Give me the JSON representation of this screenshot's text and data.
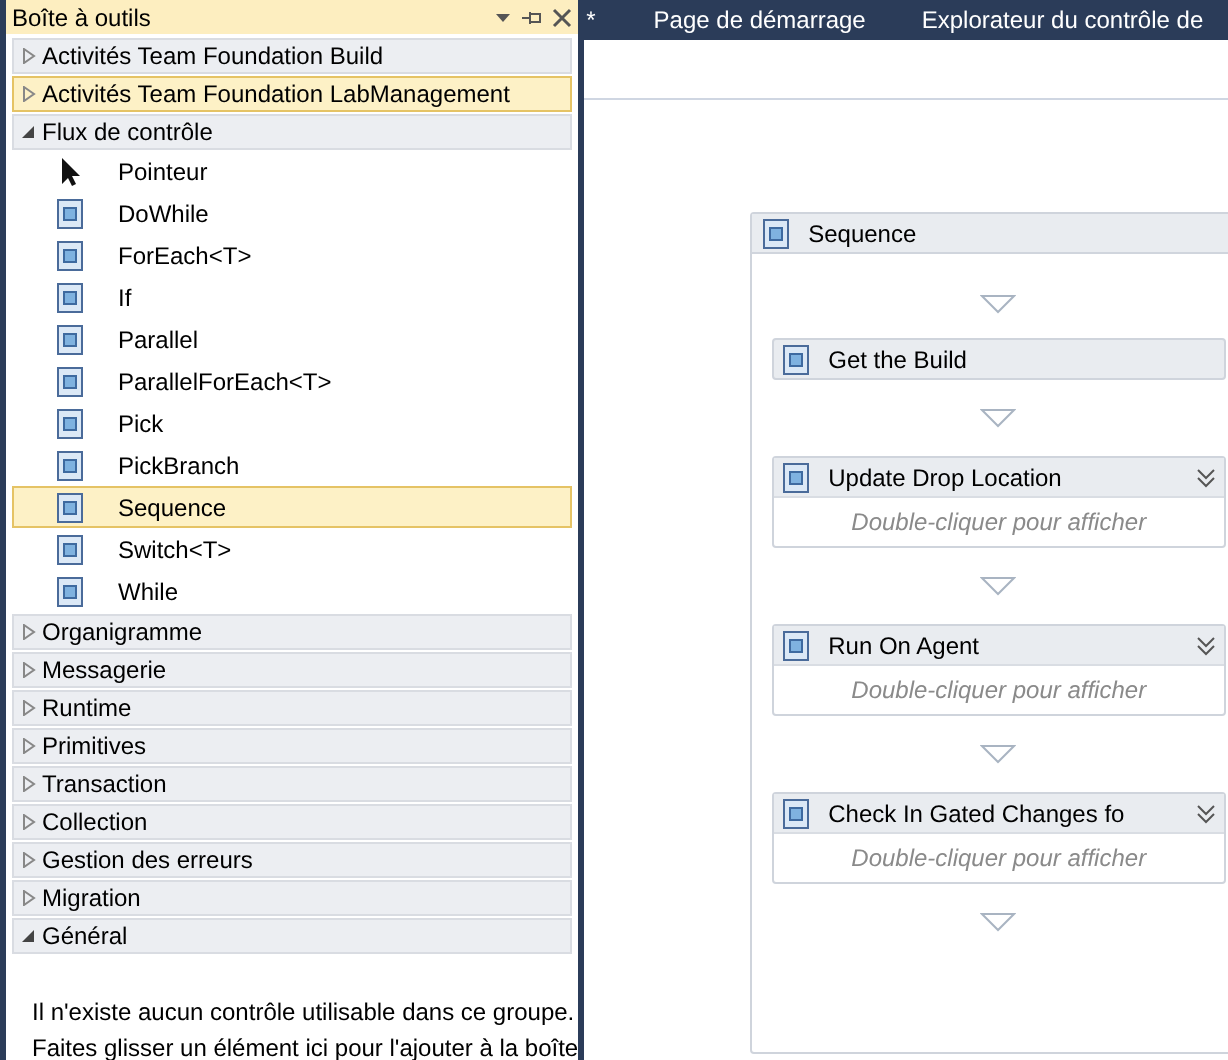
{
  "toolbox": {
    "title": "Boîte à outils",
    "categories": [
      {
        "label": "Activités Team Foundation Build",
        "expanded": false,
        "highlighted": false
      },
      {
        "label": "Activités Team Foundation LabManagement",
        "expanded": false,
        "highlighted": true
      },
      {
        "label": "Flux de contrôle",
        "expanded": true,
        "highlighted": false,
        "items": [
          {
            "label": "Pointeur",
            "kind": "pointer",
            "selected": false
          },
          {
            "label": "DoWhile",
            "kind": "activity",
            "selected": false
          },
          {
            "label": "ForEach<T>",
            "kind": "activity",
            "selected": false
          },
          {
            "label": "If",
            "kind": "activity",
            "selected": false
          },
          {
            "label": "Parallel",
            "kind": "activity",
            "selected": false
          },
          {
            "label": "ParallelForEach<T>",
            "kind": "activity",
            "selected": false
          },
          {
            "label": "Pick",
            "kind": "activity",
            "selected": false
          },
          {
            "label": "PickBranch",
            "kind": "activity",
            "selected": false
          },
          {
            "label": "Sequence",
            "kind": "activity",
            "selected": true
          },
          {
            "label": "Switch<T>",
            "kind": "activity",
            "selected": false
          },
          {
            "label": "While",
            "kind": "activity",
            "selected": false
          }
        ]
      },
      {
        "label": "Organigramme",
        "expanded": false,
        "highlighted": false
      },
      {
        "label": "Messagerie",
        "expanded": false,
        "highlighted": false
      },
      {
        "label": "Runtime",
        "expanded": false,
        "highlighted": false
      },
      {
        "label": "Primitives",
        "expanded": false,
        "highlighted": false
      },
      {
        "label": "Transaction",
        "expanded": false,
        "highlighted": false
      },
      {
        "label": "Collection",
        "expanded": false,
        "highlighted": false
      },
      {
        "label": "Gestion des erreurs",
        "expanded": false,
        "highlighted": false
      },
      {
        "label": "Migration",
        "expanded": false,
        "highlighted": false
      },
      {
        "label": "Général",
        "expanded": true,
        "highlighted": false
      }
    ],
    "empty_message": [
      "Il n'existe aucun contrôle utilisable dans ce groupe.",
      "Faites glisser un élément ici pour l'ajouter à la boîte"
    ]
  },
  "tabs": [
    {
      "label": "*",
      "selected": false
    },
    {
      "label": "Page de démarrage",
      "selected": false
    },
    {
      "label": "Explorateur du contrôle de",
      "selected": false
    }
  ],
  "designer": {
    "sequence": {
      "title": "Sequence",
      "activities": [
        {
          "title": "Get the Build",
          "kind": "simple"
        },
        {
          "title": "Update Drop Location",
          "kind": "expandable",
          "hint": "Double-cliquer pour afficher"
        },
        {
          "title": "Run On Agent",
          "kind": "expandable",
          "hint": "Double-cliquer pour afficher"
        },
        {
          "title": "Check In Gated Changes fo",
          "kind": "expandable",
          "hint": "Double-cliquer pour afficher"
        }
      ]
    }
  }
}
